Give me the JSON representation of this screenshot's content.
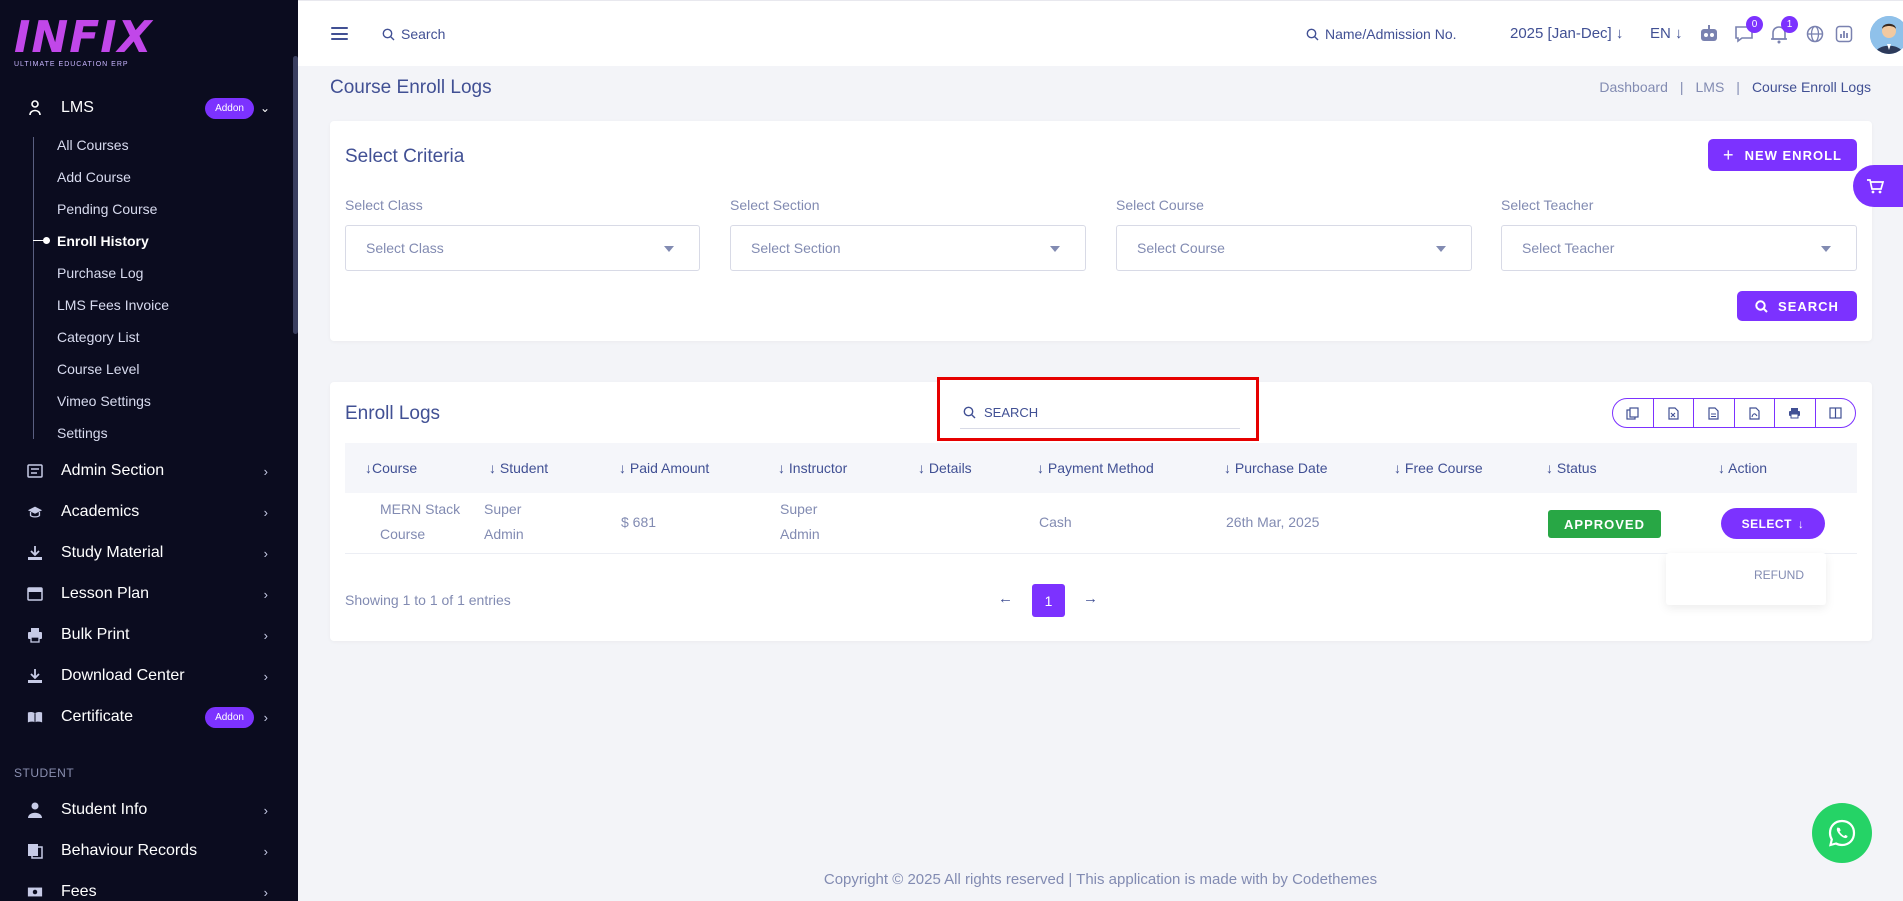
{
  "brand": {
    "logo_main": "INFIX",
    "logo_sub": "ULTIMATE EDUCATION ERP"
  },
  "sidebar": {
    "lms": {
      "label": "LMS",
      "badge": "Addon"
    },
    "lms_items": [
      "All Courses",
      "Add Course",
      "Pending Course",
      "Enroll History",
      "Purchase Log",
      "LMS Fees Invoice",
      "Category List",
      "Course Level",
      "Vimeo Settings",
      "Settings"
    ],
    "active_item": "Enroll History",
    "items": [
      {
        "label": "Admin Section"
      },
      {
        "label": "Academics"
      },
      {
        "label": "Study Material"
      },
      {
        "label": "Lesson Plan"
      },
      {
        "label": "Bulk Print"
      },
      {
        "label": "Download Center"
      },
      {
        "label": "Certificate",
        "badge": "Addon"
      }
    ],
    "section_student": "STUDENT",
    "student_items": [
      {
        "label": "Student Info"
      },
      {
        "label": "Behaviour Records"
      },
      {
        "label": "Fees"
      }
    ]
  },
  "topbar": {
    "search_label": "Search",
    "admission_search": "Name/Admission No.",
    "academic_year": "2025 [Jan-Dec]",
    "language": "EN",
    "messages_count": "0",
    "notifications_count": "1"
  },
  "page": {
    "title": "Course Enroll Logs",
    "breadcrumb": [
      "Dashboard",
      "LMS",
      "Course Enroll Logs"
    ]
  },
  "criteria": {
    "title": "Select Criteria",
    "new_enroll_label": "NEW ENROLL",
    "fields": [
      {
        "label": "Select Class",
        "value": "Select Class"
      },
      {
        "label": "Select Section",
        "value": "Select Section"
      },
      {
        "label": "Select Course",
        "value": "Select Course"
      },
      {
        "label": "Select Teacher",
        "value": "Select Teacher"
      }
    ],
    "search_label": "SEARCH"
  },
  "logs": {
    "title": "Enroll Logs",
    "search_placeholder": "SEARCH",
    "columns": [
      "Course",
      "Student",
      "Paid Amount",
      "Instructor",
      "Details",
      "Payment Method",
      "Purchase Date",
      "Free Course",
      "Status",
      "Action"
    ],
    "rows": [
      {
        "course_l1": "MERN Stack",
        "course_l2": "Course",
        "student_l1": "Super",
        "student_l2": "Admin",
        "paid_amount": "$ 681",
        "instructor_l1": "Super",
        "instructor_l2": "Admin",
        "details": "",
        "payment_method": "Cash",
        "purchase_date": "26th Mar, 2025",
        "free_course": "",
        "status": "APPROVED",
        "action_label": "SELECT"
      }
    ],
    "action_menu": [
      "REFUND"
    ],
    "entries_text": "Showing 1 to 1 of 1 entries",
    "current_page": "1"
  },
  "footer": {
    "text": "Copyright © 2025 All rights reserved | This application is made with by Codethemes"
  },
  "colors": {
    "accent": "#7c32ff",
    "sidebar_bg": "#0b0c1f",
    "text": "#415094",
    "muted": "#828bb2",
    "success": "#28a745",
    "highlight": "#e60000"
  }
}
